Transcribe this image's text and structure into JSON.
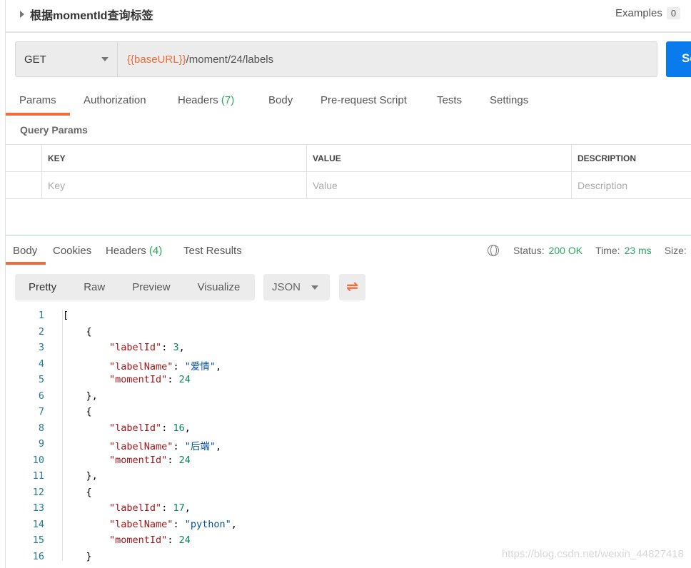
{
  "request": {
    "title": "根据momentId查询标签",
    "examples_label": "Examples",
    "examples_count": "0",
    "method": "GET",
    "url_var": "{{baseURL}}",
    "url_path": "/moment/24/labels",
    "send_label": "Se"
  },
  "req_tabs": [
    {
      "label": "Params"
    },
    {
      "label": "Authorization"
    },
    {
      "label": "Headers",
      "count": "(7)"
    },
    {
      "label": "Body"
    },
    {
      "label": "Pre-request Script"
    },
    {
      "label": "Tests"
    },
    {
      "label": "Settings"
    }
  ],
  "query": {
    "title": "Query Params",
    "headers": [
      "KEY",
      "VALUE",
      "DESCRIPTION"
    ],
    "placeholders": [
      "Key",
      "Value",
      "Description"
    ]
  },
  "resp_tabs": [
    {
      "label": "Body"
    },
    {
      "label": "Cookies"
    },
    {
      "label": "Headers",
      "count": "(4)"
    },
    {
      "label": "Test Results"
    }
  ],
  "status": {
    "status_label": "Status:",
    "status_value": "200 OK",
    "time_label": "Time:",
    "time_value": "23 ms",
    "size_label": "Size:"
  },
  "view": {
    "modes": [
      "Pretty",
      "Raw",
      "Preview",
      "Visualize"
    ],
    "format": "JSON"
  },
  "colors": {
    "accent": "#f26b3a",
    "send": "#097bed",
    "ok": "#26a65b"
  },
  "response_lines": [
    [
      [
        "p",
        "["
      ]
    ],
    [
      [
        "p",
        "    {"
      ]
    ],
    [
      [
        "p",
        "        "
      ],
      [
        "k",
        "\"labelId\""
      ],
      [
        "p",
        ": "
      ],
      [
        "n",
        "3"
      ],
      [
        "p",
        ","
      ]
    ],
    [
      [
        "p",
        "        "
      ],
      [
        "k",
        "\"labelName\""
      ],
      [
        "p",
        ": "
      ],
      [
        "s",
        "\"爱情\""
      ],
      [
        "p",
        ","
      ]
    ],
    [
      [
        "p",
        "        "
      ],
      [
        "k",
        "\"momentId\""
      ],
      [
        "p",
        ": "
      ],
      [
        "n",
        "24"
      ]
    ],
    [
      [
        "p",
        "    },"
      ]
    ],
    [
      [
        "p",
        "    {"
      ]
    ],
    [
      [
        "p",
        "        "
      ],
      [
        "k",
        "\"labelId\""
      ],
      [
        "p",
        ": "
      ],
      [
        "n",
        "16"
      ],
      [
        "p",
        ","
      ]
    ],
    [
      [
        "p",
        "        "
      ],
      [
        "k",
        "\"labelName\""
      ],
      [
        "p",
        ": "
      ],
      [
        "s",
        "\"后端\""
      ],
      [
        "p",
        ","
      ]
    ],
    [
      [
        "p",
        "        "
      ],
      [
        "k",
        "\"momentId\""
      ],
      [
        "p",
        ": "
      ],
      [
        "n",
        "24"
      ]
    ],
    [
      [
        "p",
        "    },"
      ]
    ],
    [
      [
        "p",
        "    {"
      ]
    ],
    [
      [
        "p",
        "        "
      ],
      [
        "k",
        "\"labelId\""
      ],
      [
        "p",
        ": "
      ],
      [
        "n",
        "17"
      ],
      [
        "p",
        ","
      ]
    ],
    [
      [
        "p",
        "        "
      ],
      [
        "k",
        "\"labelName\""
      ],
      [
        "p",
        ": "
      ],
      [
        "s",
        "\"python\""
      ],
      [
        "p",
        ","
      ]
    ],
    [
      [
        "p",
        "        "
      ],
      [
        "k",
        "\"momentId\""
      ],
      [
        "p",
        ": "
      ],
      [
        "n",
        "24"
      ]
    ],
    [
      [
        "p",
        "    }"
      ]
    ]
  ],
  "watermark": "https://blog.csdn.net/weixin_44827418"
}
